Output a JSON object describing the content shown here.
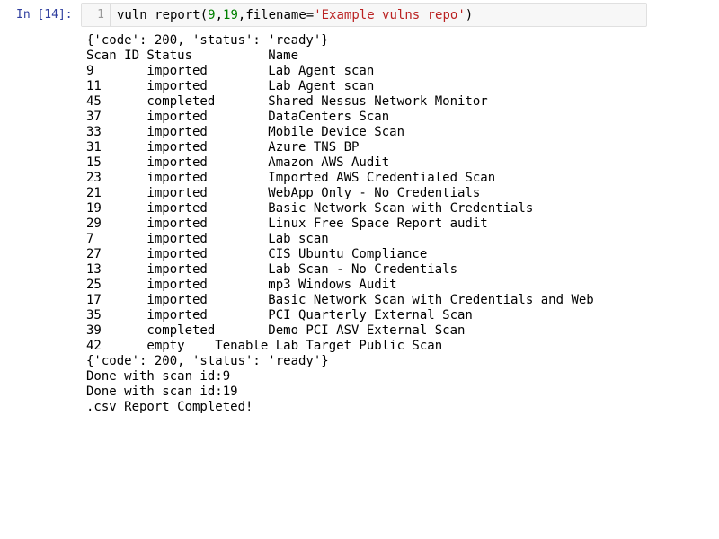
{
  "cell": {
    "prompt": "In [14]:",
    "line_number": "1",
    "code": {
      "func": "vuln_report(",
      "arg1": "9",
      "comma1": ",",
      "arg2": "19",
      "kw": ",filename=",
      "str": "'Example_vulns_repo'",
      "close": ")"
    }
  },
  "output": {
    "lines": [
      "{'code': 200, 'status': 'ready'}",
      "Scan ID Status          Name",
      "9       imported        Lab Agent scan",
      "11      imported        Lab Agent scan",
      "45      completed       Shared Nessus Network Monitor",
      "37      imported        DataCenters Scan",
      "33      imported        Mobile Device Scan",
      "31      imported        Azure TNS BP",
      "15      imported        Amazon AWS Audit",
      "23      imported        Imported AWS Credentialed Scan",
      "21      imported        WebApp Only - No Credentials",
      "19      imported        Basic Network Scan with Credentials",
      "29      imported        Linux Free Space Report audit",
      "7       imported        Lab scan",
      "27      imported        CIS Ubuntu Compliance",
      "13      imported        Lab Scan - No Credentials",
      "25      imported        mp3 Windows Audit",
      "17      imported        Basic Network Scan with Credentials and Web",
      "35      imported        PCI Quarterly External Scan",
      "39      completed       Demo PCI ASV External Scan",
      "42      empty    Tenable Lab Target Public Scan",
      "{'code': 200, 'status': 'ready'}",
      "Done with scan id:9",
      "Done with scan id:19",
      ".csv Report Completed!"
    ]
  }
}
